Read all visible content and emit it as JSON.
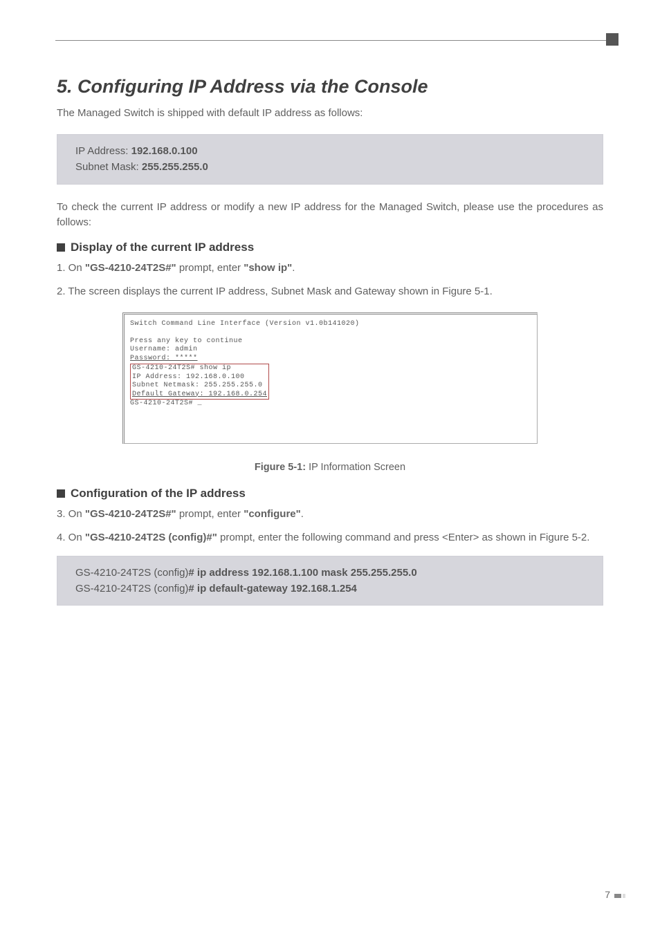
{
  "header": {
    "title": "5. Configuring IP Address via the Console",
    "intro": "The Managed Switch is shipped with default IP address as follows:"
  },
  "defaults_box": {
    "ip_label": "IP Address: ",
    "ip_value": "192.168.0.100",
    "mask_label": "Subnet Mask: ",
    "mask_value": "255.255.255.0"
  },
  "para_check": "To check the current IP address or modify a new IP address for the Managed Switch, please use the procedures as follows:",
  "section_display": {
    "heading": "Display of the current IP address",
    "step1_pre": "1. On ",
    "step1_prompt": "\"GS-4210-24T2S#\"",
    "step1_mid": " prompt, enter ",
    "step1_cmd": "\"show ip\"",
    "step1_post": ".",
    "step2": "2. The screen displays the current IP address, Subnet Mask and Gateway shown in Figure 5-1."
  },
  "terminal": {
    "line1": "Switch Command Line Interface (Version v1.0b141020)",
    "line2": "Press any key to continue",
    "line3a": "Username: admin",
    "line3b": "Password: *****",
    "box_line1": "GS-4210-24T2S# show ip",
    "box_line2": "IP Address: 192.168.0.100",
    "box_line3": "Subnet Netmask: 255.255.255.0",
    "box_line4": "Default Gateway: 192.168.0.254",
    "line_last": "GS-4210-24T2S# _"
  },
  "fig_caption": {
    "bold": "Figure 5-1:",
    "rest": "  IP Information Screen"
  },
  "section_config": {
    "heading": "Configuration of the IP address",
    "step3_pre": "3. On ",
    "step3_prompt": "\"GS-4210-24T2S#\"",
    "step3_mid": " prompt, enter ",
    "step3_cmd": "\"configure\"",
    "step3_post": ".",
    "step4_pre": "4. On ",
    "step4_prompt": "\"GS-4210-24T2S (config)#\"",
    "step4_mid": " prompt, enter the following command and press <Enter> as shown in Figure 5-2."
  },
  "config_box": {
    "line1_plain": "GS-4210-24T2S (config)",
    "line1_bold": "# ip address 192.168.1.100 mask 255.255.255.0",
    "line2_plain": "GS-4210-24T2S (config)",
    "line2_bold": "# ip default-gateway 192.168.1.254"
  },
  "page_number": "7"
}
